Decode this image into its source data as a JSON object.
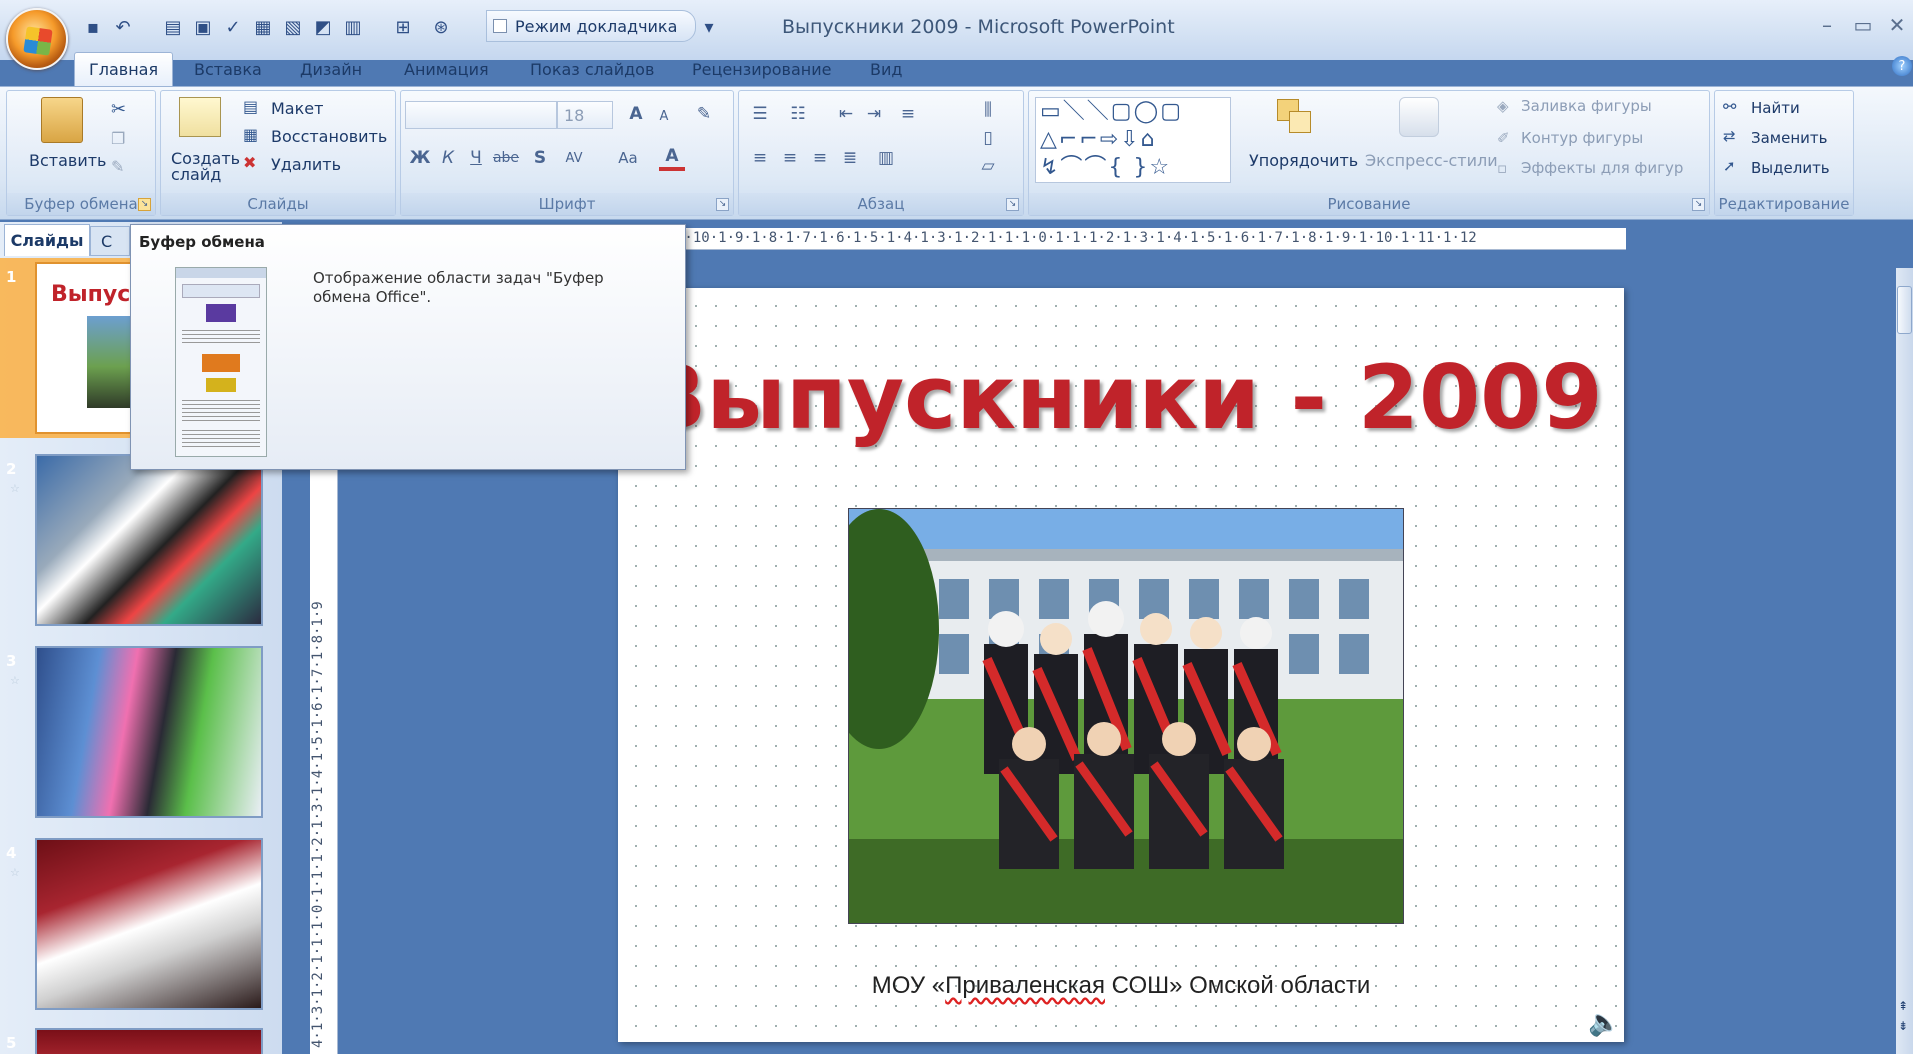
{
  "window": {
    "title": "Выпускники 2009 - Microsoft PowerPoint"
  },
  "quick_access": {
    "speaker_mode_label": "Режим докладчика"
  },
  "tabs": [
    {
      "label": "Главная"
    },
    {
      "label": "Вставка"
    },
    {
      "label": "Дизайн"
    },
    {
      "label": "Анимация"
    },
    {
      "label": "Показ слайдов"
    },
    {
      "label": "Рецензирование"
    },
    {
      "label": "Вид"
    }
  ],
  "ribbon": {
    "clipboard": {
      "paste_label": "Вставить",
      "group_label": "Буфер обмена"
    },
    "slides": {
      "new_slide_label": "Создать слайд",
      "layout_label": "Макет",
      "reset_label": "Восстановить",
      "delete_label": "Удалить",
      "group_label": "Слайды"
    },
    "font": {
      "size_value": "18",
      "group_label": "Шрифт",
      "bold": "Ж",
      "italic": "К",
      "underline": "Ч",
      "strike": "abe",
      "shadow": "S",
      "spacing": "AV",
      "case": "Aa",
      "grow": "A",
      "shrink": "A"
    },
    "paragraph": {
      "group_label": "Абзац"
    },
    "drawing": {
      "arrange_label": "Упорядочить",
      "quick_styles_label": "Экспресс-стили",
      "fill_label": "Заливка фигуры",
      "outline_label": "Контур фигуры",
      "effects_label": "Эффекты для фигур",
      "group_label": "Рисование"
    },
    "editing": {
      "find_label": "Найти",
      "replace_label": "Заменить",
      "select_label": "Выделить",
      "group_label": "Редактирование"
    }
  },
  "panel": {
    "slides_tab": "Слайды",
    "outline_tab": "С",
    "close": "×"
  },
  "thumbnails": [
    {
      "number": "1",
      "title_fragment": "Выпуск"
    },
    {
      "number": "2"
    },
    {
      "number": "3"
    },
    {
      "number": "4"
    },
    {
      "number": "5"
    }
  ],
  "ruler": {
    "text": "1·10·1·9·1·8·1·7·1·6·1·5·1·4·1·3·1·2·1·1·1·0·1·1·1·2·1·3·1·4·1·5·1·6·1·7·1·8·1·9·1·10·1·11·1·12"
  },
  "vruler": {
    "text": "4·1·3·1·2·1·1·1·0·1·1·1·2·1·3·1·4·1·5·1·6·1·7·1·8·1·9"
  },
  "slide": {
    "title": "Выпускники - 2009",
    "caption_pre": "МОУ «",
    "caption_underlined": "Приваленская",
    "caption_post": " СОШ» Омской области"
  },
  "tooltip": {
    "title": "Буфер обмена",
    "body": "Отображение области задач \"Буфер обмена Office\"."
  },
  "colors": {
    "accent": "#c0232a",
    "ribbon": "#dae6f4",
    "background": "#4f79b3",
    "selected_thumb": "#f9b24b"
  }
}
